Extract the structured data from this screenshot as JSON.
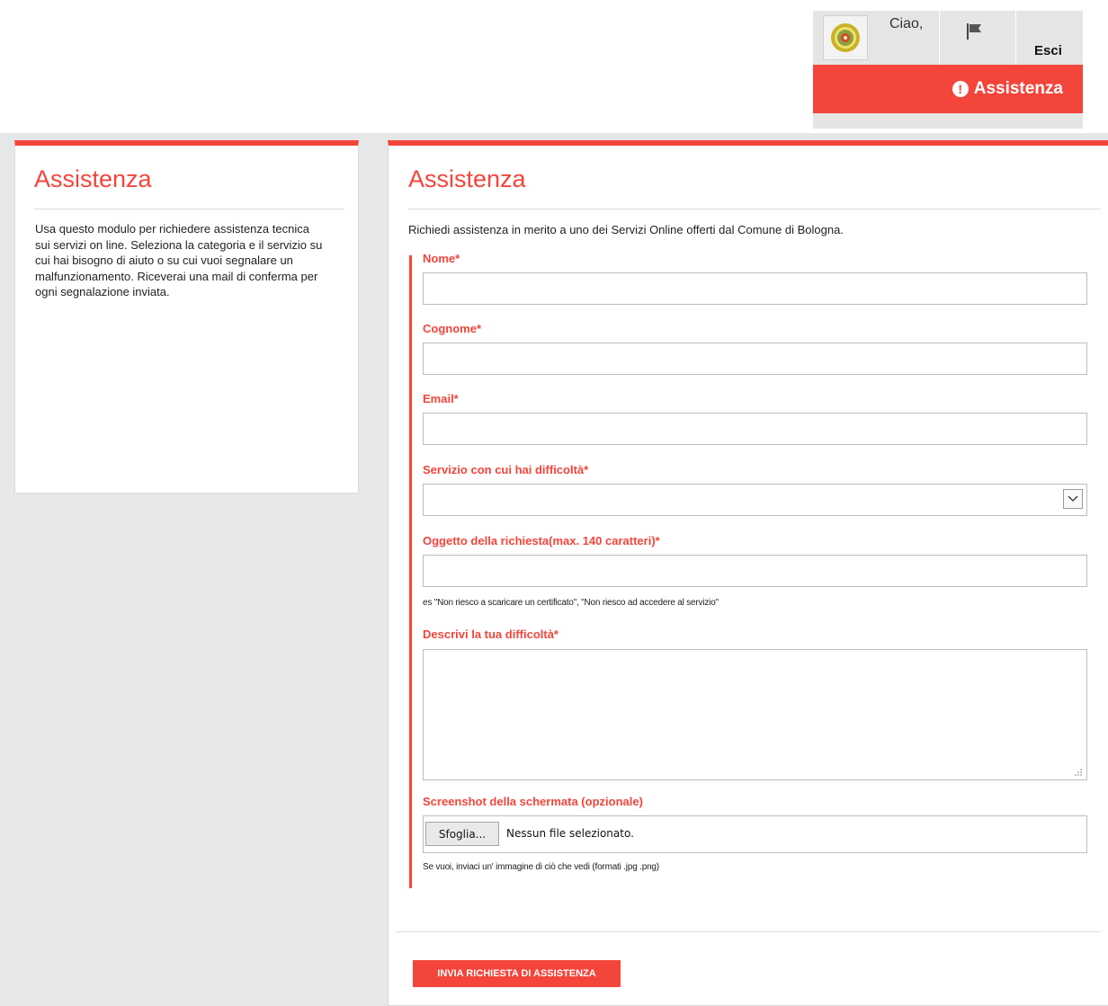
{
  "header": {
    "greeting": "Ciao,",
    "logout_label": "Esci",
    "assist_button_label": "Assistenza",
    "avatar_icon": "city-emblem-icon",
    "flag_icon": "flag-icon"
  },
  "sidebar": {
    "title": "Assistenza",
    "description": "Usa questo modulo per richiedere assistenza tecnica sui servizi on line. Seleziona la categoria e il servizio su cui hai bisogno di aiuto o su cui vuoi segnalare un malfunzionamento. Riceverai una mail di conferma per ogni segnalazione inviata."
  },
  "main": {
    "title": "Assistenza",
    "intro": "Richiedi assistenza in merito a uno dei Servizi Online offerti dal Comune di Bologna.",
    "fields": {
      "nome": {
        "label": "Nome*",
        "value": ""
      },
      "cognome": {
        "label": "Cognome*",
        "value": ""
      },
      "email": {
        "label": "Email*",
        "value": ""
      },
      "servizio": {
        "label": "Servizio con cui hai difficoltà*",
        "value": ""
      },
      "oggetto": {
        "label": "Oggetto della richiesta(max. 140 caratteri)*",
        "value": "",
        "hint": "es \"Non riesco a scaricare un certificato\", \"Non riesco ad accedere al servizio\""
      },
      "descrizione": {
        "label": "Descrivi la tua difficoltà*",
        "value": ""
      },
      "screenshot": {
        "label": "Screenshot della schermata (opzionale)",
        "browse_label": "Sfoglia...",
        "status": "Nessun file selezionato.",
        "hint": "Se vuoi, inviaci un' immagine di ciò che vedi (formati .jpg .png)"
      }
    },
    "submit_label": "INVIA RICHIESTA DI ASSISTENZA"
  },
  "colors": {
    "accent": "#f3453a",
    "background": "#e6e7e8",
    "header_gray": "#e5e5e5"
  }
}
